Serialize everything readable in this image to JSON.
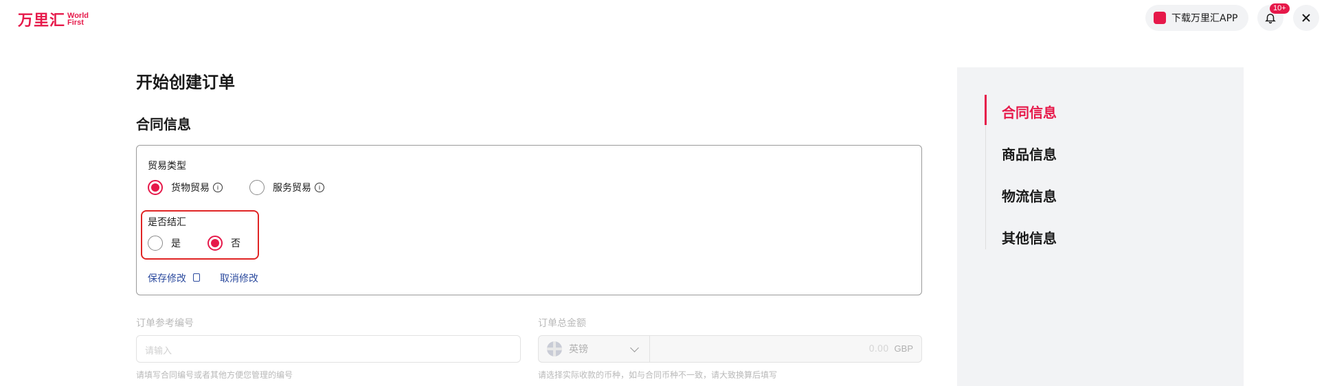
{
  "header": {
    "logo_cn": "万里汇",
    "logo_en_line1": "World",
    "logo_en_line2": "First",
    "download_app_label": "下载万里汇APP",
    "notification_badge": "10+"
  },
  "page": {
    "title": "开始创建订单"
  },
  "contract_section": {
    "title": "合同信息",
    "trade_type": {
      "label": "贸易类型",
      "options": [
        {
          "label": "货物贸易",
          "selected": true
        },
        {
          "label": "服务贸易",
          "selected": false
        }
      ]
    },
    "settlement": {
      "label": "是否结汇",
      "options": [
        {
          "label": "是",
          "selected": false
        },
        {
          "label": "否",
          "selected": true
        }
      ]
    },
    "save_label": "保存修改",
    "cancel_label": "取消修改"
  },
  "order_ref": {
    "label": "订单参考编号",
    "placeholder": "请输入",
    "hint": "请填写合同编号或者其他方便您管理的编号"
  },
  "order_amount": {
    "label": "订单总金额",
    "currency": "英镑",
    "amount_placeholder": "0.00",
    "currency_code": "GBP",
    "hint": "请选择实际收款的币种，如与合同币种不一致，请大致换算后填写"
  },
  "side_nav": {
    "items": [
      {
        "label": "合同信息",
        "active": true
      },
      {
        "label": "商品信息",
        "active": false
      },
      {
        "label": "物流信息",
        "active": false
      },
      {
        "label": "其他信息",
        "active": false
      }
    ]
  },
  "colors": {
    "brand": "#e6194a",
    "link": "#2b4a9e",
    "highlight_border": "#e02424"
  }
}
